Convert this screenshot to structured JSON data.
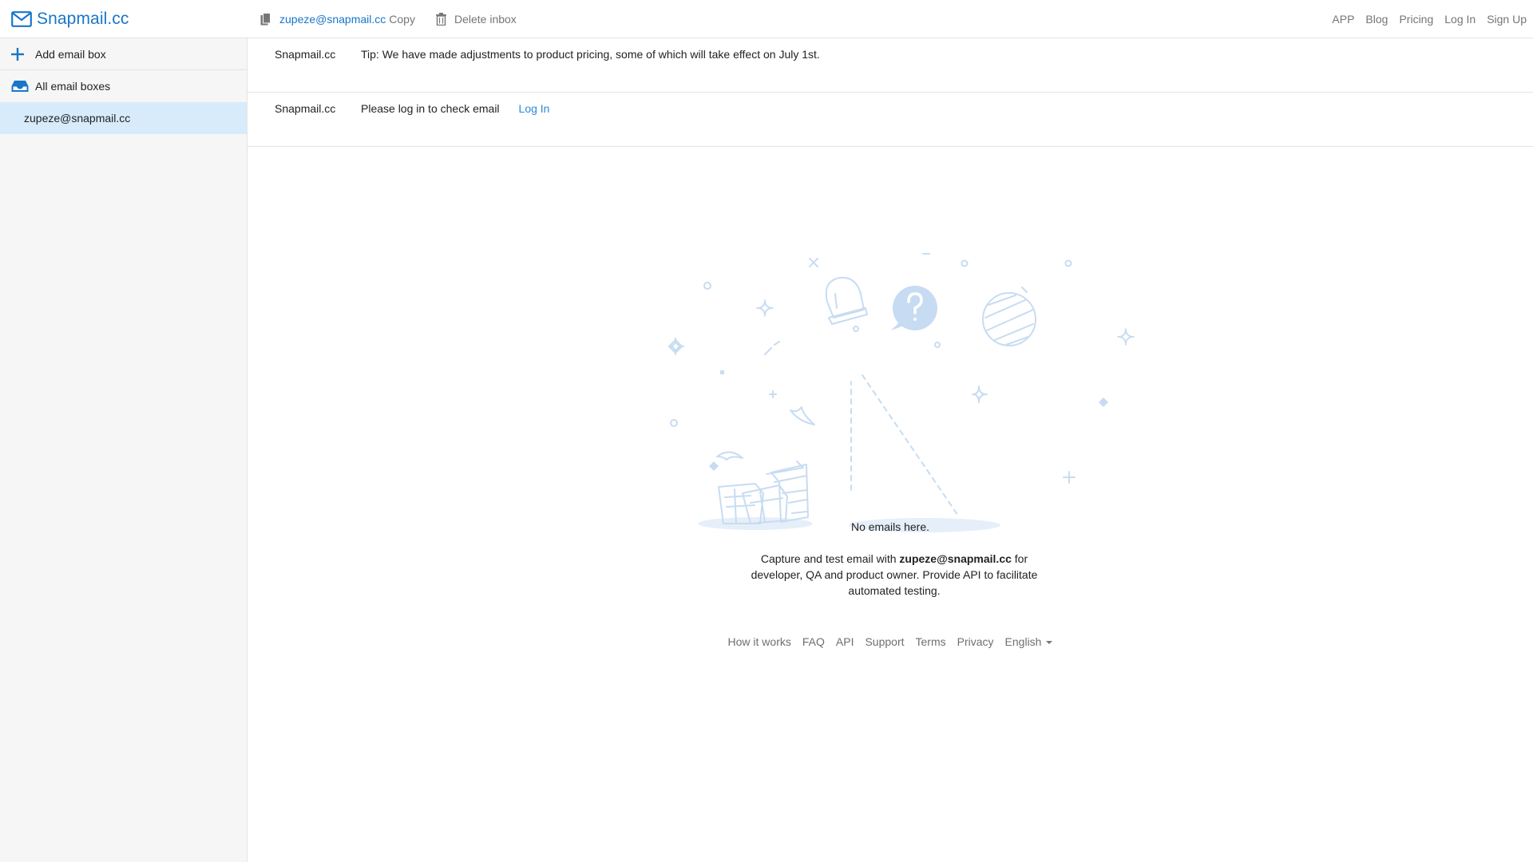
{
  "brand": {
    "name": "Snapmail.cc"
  },
  "toolbar": {
    "address": "zupeze@snapmail.cc",
    "copy_label": "Copy",
    "delete_label": "Delete inbox"
  },
  "topnav": {
    "items": [
      "APP",
      "Blog",
      "Pricing",
      "Log In",
      "Sign Up"
    ]
  },
  "sidebar": {
    "add_label": "Add email box",
    "all_label": "All email boxes",
    "box_label": "zupeze@snapmail.cc"
  },
  "notices": [
    {
      "from": "Snapmail.cc",
      "message": "Tip: We have made adjustments to product pricing, some of which will take effect on July 1st."
    },
    {
      "from": "Snapmail.cc",
      "message": "Please log in to check email",
      "link": "Log In"
    }
  ],
  "empty": {
    "title": "No emails here.",
    "desc_before": "Capture and test email with ",
    "desc_bold": "zupeze@snapmail.cc",
    "desc_after": " for developer, QA and product owner. Provide API to facilitate automated testing."
  },
  "footer": {
    "items": [
      "How it works",
      "FAQ",
      "API",
      "Support",
      "Terms",
      "Privacy"
    ],
    "language": "English"
  },
  "colors": {
    "accent": "#1976c8",
    "selected_bg": "#d7ebfb",
    "illustration": "#c7dcf2"
  }
}
